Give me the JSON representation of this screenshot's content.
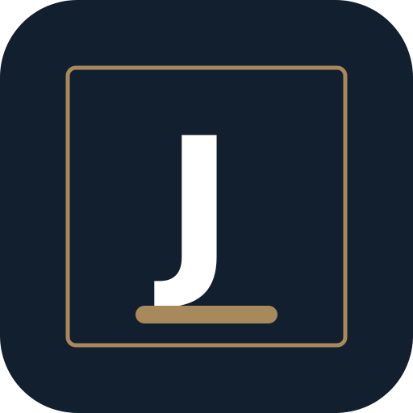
{
  "app_icon": {
    "icon": "app-logo-icon",
    "letter": "J",
    "colors": {
      "background": "#121F2F",
      "frame": "#A8895C",
      "letter": "#FFFFFF",
      "underline": "#A8895C"
    }
  }
}
